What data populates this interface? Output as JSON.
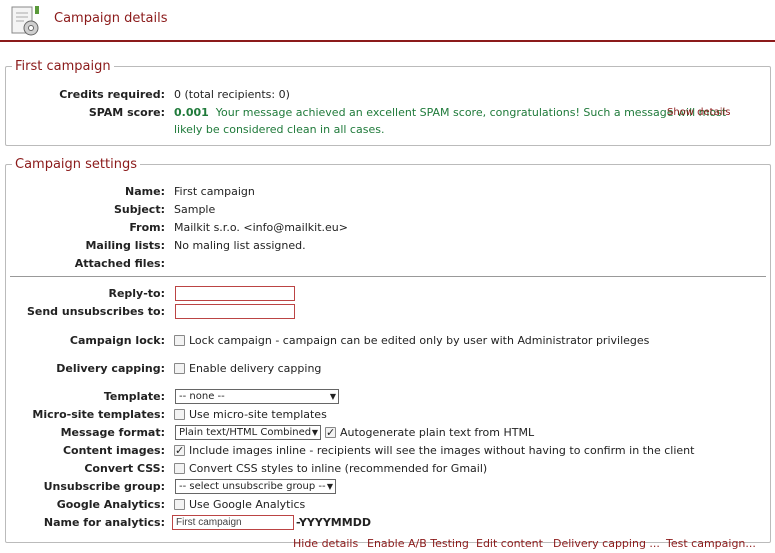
{
  "header": {
    "title": "Campaign details",
    "icon": "campaign-gear-icon"
  },
  "summary": {
    "legend": "First campaign",
    "credits_label": "Credits required:",
    "credits_value": "0 (total recipients: 0)",
    "spam_label": "SPAM score:",
    "spam_score": "0.001",
    "spam_message": "Your message achieved an excellent SPAM score, congratulations! Such a message will most",
    "spam_message_2": "likely be considered clean in all cases.",
    "show_details": "Show details"
  },
  "settings": {
    "legend": "Campaign settings",
    "name_label": "Name:",
    "name_value": "First campaign",
    "subject_label": "Subject:",
    "subject_value": "Sample",
    "from_label": "From:",
    "from_value": "Mailkit s.r.o. <info@mailkit.eu>",
    "lists_label": "Mailing lists:",
    "lists_value": "No maling list assigned.",
    "files_label": "Attached files:",
    "replyto_label": "Reply-to:",
    "replyto_value": "",
    "unsub_label": "Send unsubscribes to:",
    "unsub_value": "",
    "lock_label": "Campaign lock:",
    "lock_text": "Lock campaign - campaign can be edited only by user with Administrator privileges",
    "capping_label": "Delivery capping:",
    "capping_text": "Enable delivery capping",
    "template_label": "Template:",
    "template_value": "-- none --",
    "microsite_label": "Micro-site templates:",
    "microsite_text": "Use micro-site templates",
    "format_label": "Message format:",
    "format_value": "Plain text/HTML Combined",
    "autogen_text": "Autogenerate plain text from HTML",
    "images_label": "Content images:",
    "images_text": "Include images inline - recipients will see the images without having to confirm in the client",
    "css_label": "Convert CSS:",
    "css_text": "Convert CSS styles to inline (recommended for Gmail)",
    "unsubgroup_label": "Unsubscribe group:",
    "unsubgroup_value": "-- select unsubscribe group --",
    "ga_label": "Google Analytics:",
    "ga_text": "Use Google Analytics",
    "analytics_name_label": "Name for analytics:",
    "analytics_name_value": "First campaign",
    "analytics_suffix": "-YYYYMMDD"
  },
  "checkboxes": {
    "lock": false,
    "capping": false,
    "microsite": false,
    "autogen": true,
    "images": true,
    "css": false,
    "ga": false
  },
  "actions": {
    "hide_details": "Hide details",
    "ab_testing": "Enable A/B Testing",
    "edit_content": "Edit content",
    "delivery_capping": "Delivery capping ...",
    "test_campaign": "Test campaign..."
  },
  "colors": {
    "accent": "#8b1a1a",
    "success": "#1f7a3a"
  }
}
